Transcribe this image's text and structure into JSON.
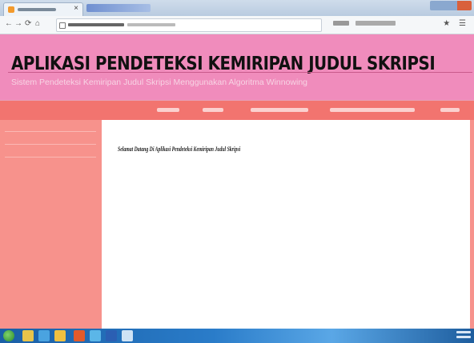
{
  "browser": {
    "tab_close_glyph": "×",
    "nav_back": "←",
    "nav_forward": "→",
    "nav_refresh": "⟳",
    "nav_home": "⌂",
    "toolbar_icons": "★ ☰"
  },
  "app": {
    "title": "APLIKASI PENDETEKSI KEMIRIPAN JUDUL SKRIPSI",
    "subtitle": "Sistem Pendeteksi Kemiripan Judul Skripsi Menggunakan Algoritma Winnowing"
  },
  "content": {
    "welcome": "Selamat Datang Di Aplikasi Pendeteksi Kemiripan Judul Skripsi"
  },
  "colors": {
    "header_bg": "#f08cbc",
    "menubar_bg": "#f2746f",
    "sidebar_bg": "#f7928c",
    "content_bg": "#ffffff"
  },
  "icons": {
    "start": "windows-start-icon",
    "taskbar": [
      "explorer-icon",
      "media-player-icon",
      "folder-icon",
      "firefox-icon",
      "app-icon",
      "word-icon",
      "paint-icon"
    ]
  }
}
